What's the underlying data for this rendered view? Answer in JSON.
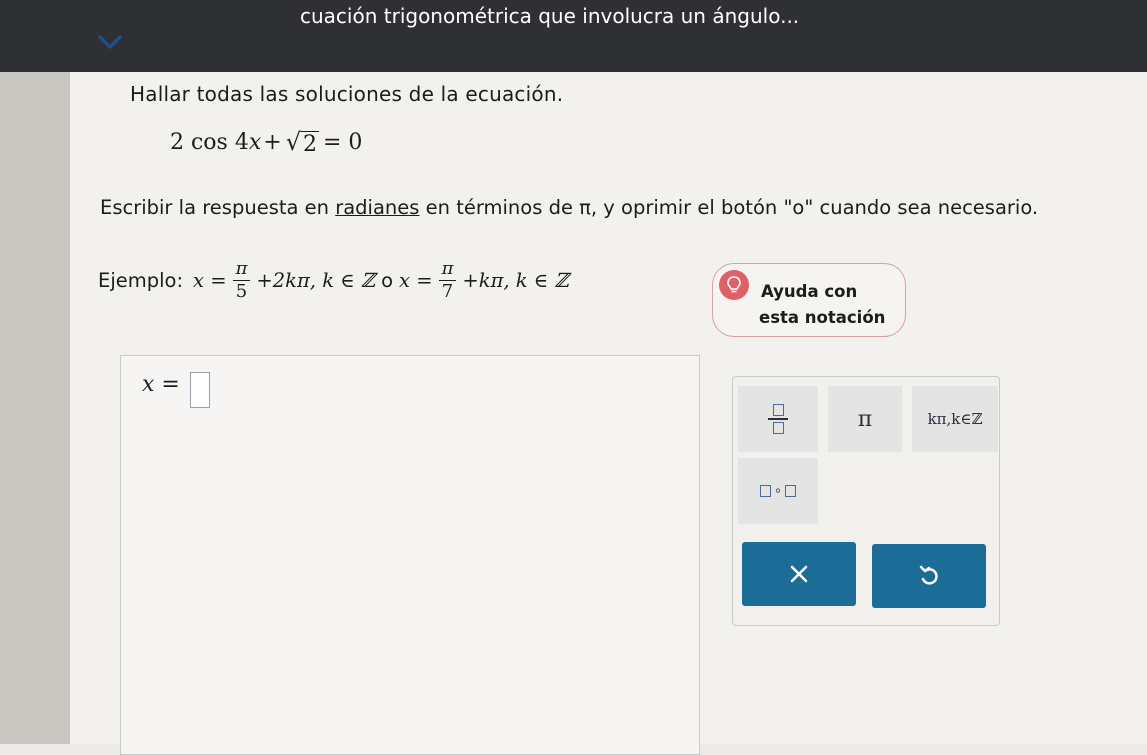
{
  "header": {
    "title": "cuación trigonométrica que involucra un ángulo..."
  },
  "problem": {
    "instruction": "Hallar todas las soluciones de la ecuación.",
    "equation": {
      "left": "2 cos 4",
      "var": "x",
      "plus": "+",
      "radicand": "2",
      "right": "= 0"
    },
    "note": {
      "before_link": "Escribir la respuesta en ",
      "link": "radianes",
      "after_link": " en términos de π, y oprimir el botón \"o\" cuando sea necesario."
    },
    "example": {
      "label": "Ejemplo:",
      "x_eq_1": "x =",
      "frac1_num": "π",
      "frac1_den": "5",
      "tail1": "+2kπ, k ∈ ℤ",
      "or": "o",
      "x_eq_2": "x =",
      "frac2_num": "π",
      "frac2_den": "7",
      "tail2": "+kπ, k ∈ ℤ"
    }
  },
  "help": {
    "line1": "Ayuda con",
    "line2": "esta notación",
    "icon": "lightbulb-icon"
  },
  "answer": {
    "label": "x ="
  },
  "palette": {
    "fraction_icon": "fraction-icon",
    "pi": "π",
    "kpi": "kπ,k∈ℤ",
    "or_symbol": "∘"
  },
  "colors": {
    "topbar": "#2f3033",
    "button": "#1c6c98",
    "help_icon": "#e0606a"
  }
}
